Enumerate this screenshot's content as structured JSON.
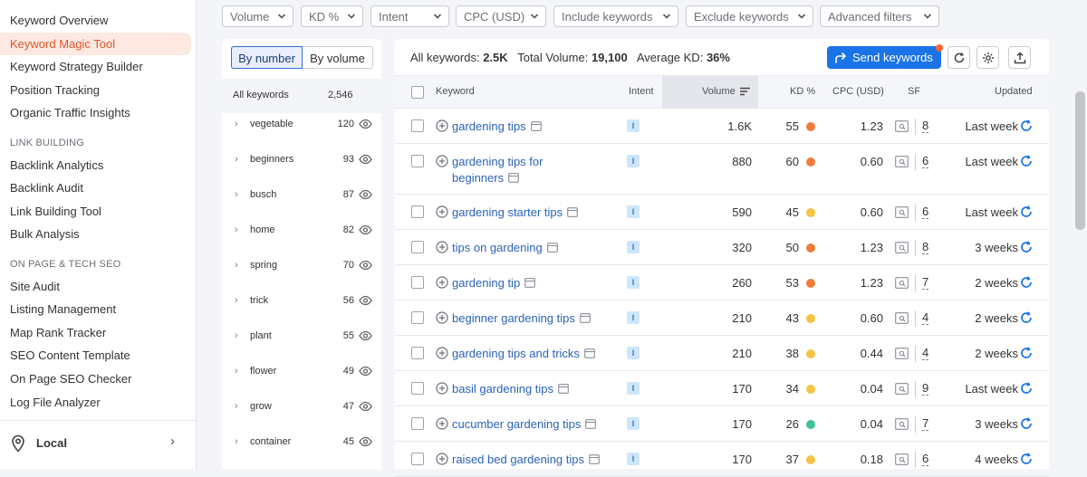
{
  "sidebar": {
    "top_items": [
      {
        "label": "Keyword Overview",
        "active": false
      },
      {
        "label": "Keyword Magic Tool",
        "active": true
      },
      {
        "label": "Keyword Strategy Builder",
        "active": false
      },
      {
        "label": "Position Tracking",
        "active": false
      },
      {
        "label": "Organic Traffic Insights",
        "active": false
      }
    ],
    "link_building_title": "LINK BUILDING",
    "link_building_items": [
      "Backlink Analytics",
      "Backlink Audit",
      "Link Building Tool",
      "Bulk Analysis"
    ],
    "onpage_title": "ON PAGE & TECH SEO",
    "onpage_items": [
      "Site Audit",
      "Listing Management",
      "Map Rank Tracker",
      "SEO Content Template",
      "On Page SEO Checker",
      "Log File Analyzer"
    ],
    "bottom_label": "Local",
    "active_color": "#e0562a"
  },
  "filters": [
    "Volume",
    "KD %",
    "Intent",
    "CPC (USD)",
    "Include keywords",
    "Exclude keywords",
    "Advanced filters"
  ],
  "groups": {
    "by_number_label": "By number",
    "by_volume_label": "By volume",
    "all_label": "All keywords",
    "all_count": "2,546",
    "items": [
      {
        "name": "vegetable",
        "count": "120"
      },
      {
        "name": "beginners",
        "count": "93"
      },
      {
        "name": "busch",
        "count": "87"
      },
      {
        "name": "home",
        "count": "82"
      },
      {
        "name": "spring",
        "count": "70"
      },
      {
        "name": "trick",
        "count": "56"
      },
      {
        "name": "plant",
        "count": "55"
      },
      {
        "name": "flower",
        "count": "49"
      },
      {
        "name": "grow",
        "count": "47"
      },
      {
        "name": "container",
        "count": "45"
      }
    ]
  },
  "summary": {
    "all_label": "All keywords:",
    "all_value": "2.5K",
    "volume_label": "Total Volume:",
    "volume_value": "19,100",
    "kd_label": "Average KD:",
    "kd_value": "36%"
  },
  "actions": {
    "send_label": "Send keywords",
    "accent": "#1a73e8"
  },
  "table": {
    "headers": {
      "keyword": "Keyword",
      "intent": "Intent",
      "volume": "Volume",
      "kd": "KD %",
      "cpc": "CPC (USD)",
      "sf": "SF",
      "updated": "Updated"
    },
    "rows": [
      {
        "keyword": "gardening tips",
        "intent": "I",
        "volume": "1.6K",
        "kd": "55",
        "kd_color": "#f07c3a",
        "cpc": "1.23",
        "sf": "8",
        "updated": "Last week"
      },
      {
        "keyword": "gardening tips for beginners",
        "intent": "I",
        "volume": "880",
        "kd": "60",
        "kd_color": "#f07c3a",
        "cpc": "0.60",
        "sf": "6",
        "updated": "Last week"
      },
      {
        "keyword": "gardening starter tips",
        "intent": "I",
        "volume": "590",
        "kd": "45",
        "kd_color": "#f6c343",
        "cpc": "0.60",
        "sf": "6",
        "updated": "Last week"
      },
      {
        "keyword": "tips on gardening",
        "intent": "I",
        "volume": "320",
        "kd": "50",
        "kd_color": "#f07c3a",
        "cpc": "1.23",
        "sf": "8",
        "updated": "3 weeks"
      },
      {
        "keyword": "gardening tip",
        "intent": "I",
        "volume": "260",
        "kd": "53",
        "kd_color": "#f07c3a",
        "cpc": "1.23",
        "sf": "7",
        "updated": "2 weeks"
      },
      {
        "keyword": "beginner gardening tips",
        "intent": "I",
        "volume": "210",
        "kd": "43",
        "kd_color": "#f6c343",
        "cpc": "0.60",
        "sf": "4",
        "updated": "2 weeks"
      },
      {
        "keyword": "gardening tips and tricks",
        "intent": "I",
        "volume": "210",
        "kd": "38",
        "kd_color": "#f6c343",
        "cpc": "0.44",
        "sf": "4",
        "updated": "2 weeks"
      },
      {
        "keyword": "basil gardening tips",
        "intent": "I",
        "volume": "170",
        "kd": "34",
        "kd_color": "#f6c343",
        "cpc": "0.04",
        "sf": "9",
        "updated": "Last week"
      },
      {
        "keyword": "cucumber gardening tips",
        "intent": "I",
        "volume": "170",
        "kd": "26",
        "kd_color": "#3fc49a",
        "cpc": "0.04",
        "sf": "7",
        "updated": "3 weeks"
      },
      {
        "keyword": "raised bed gardening tips",
        "intent": "I",
        "volume": "170",
        "kd": "37",
        "kd_color": "#f6c343",
        "cpc": "0.18",
        "sf": "6",
        "updated": "4 weeks"
      }
    ]
  }
}
